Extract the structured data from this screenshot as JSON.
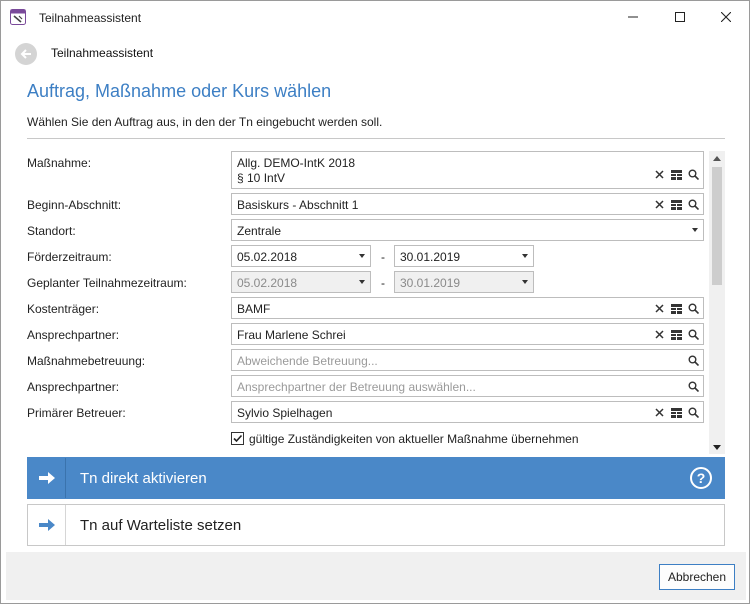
{
  "window": {
    "title": "Teilnahmeassistent"
  },
  "header": {
    "title": "Teilnahmeassistent"
  },
  "page": {
    "title": "Auftrag, Maßnahme oder Kurs wählen",
    "subtitle": "Wählen Sie den Auftrag aus, in den der Tn eingebucht werden soll."
  },
  "form": {
    "massnahme": {
      "label": "Maßnahme:",
      "line1": "Allg. DEMO-IntK 2018",
      "line2": "§ 10 IntV"
    },
    "beginn": {
      "label": "Beginn-Abschnitt:",
      "value": "Basiskurs - Abschnitt 1"
    },
    "standort": {
      "label": "Standort:",
      "value": "Zentrale"
    },
    "foerderzeitraum": {
      "label": "Förderzeitraum:",
      "from": "05.02.2018",
      "to": "30.01.2019",
      "separator": "-"
    },
    "geplant": {
      "label": "Geplanter Teilnahmezeitraum:",
      "from": "05.02.2018",
      "to": "30.01.2019",
      "separator": "-"
    },
    "kostentraeger": {
      "label": "Kostenträger:",
      "value": "BAMF"
    },
    "ansprechpartner1": {
      "label": "Ansprechpartner:",
      "value": "Frau Marlene Schrei"
    },
    "massnahmebetreuung": {
      "label": "Maßnahmebetreuung:",
      "placeholder": "Abweichende Betreuung..."
    },
    "ansprechpartner2": {
      "label": "Ansprechpartner:",
      "placeholder": "Ansprechpartner der Betreuung auswählen..."
    },
    "betreuer": {
      "label": "Primärer Betreuer:",
      "value": "Sylvio Spielhagen"
    },
    "checkbox": {
      "label": "gültige Zuständigkeiten von aktueller Maßnahme übernehmen",
      "checked": true
    }
  },
  "actions": {
    "activate": {
      "label": "Tn direkt aktivieren"
    },
    "waitlist": {
      "label": "Tn auf Warteliste setzen"
    },
    "help_glyph": "?"
  },
  "footer": {
    "cancel_label": "Abbrechen"
  },
  "colors": {
    "accent": "#3d7fc4",
    "tile_primary": "#4a88c8"
  },
  "icons": [
    "app-icon",
    "minimize-icon",
    "maximize-icon",
    "close-icon",
    "back-arrow-icon",
    "clear-icon",
    "list-icon",
    "search-icon",
    "dropdown-icon",
    "arrow-right-icon",
    "help-icon",
    "scroll-up-icon",
    "scroll-down-icon",
    "checkmark-icon"
  ]
}
